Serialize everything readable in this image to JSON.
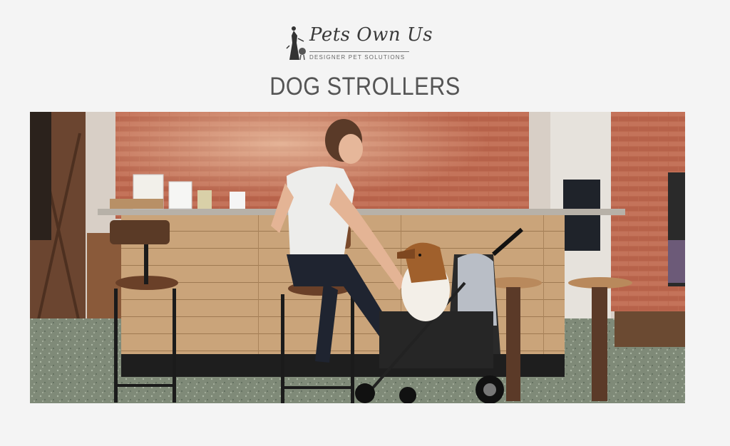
{
  "brand": {
    "name": "Pets Own Us",
    "tagline": "DESIGNER PET SOLUTIONS",
    "logo_icon": "pet-figure-logo-icon"
  },
  "page": {
    "title": "DOG STROLLERS"
  },
  "hero": {
    "alt": "Woman seated at a wooden bar counter petting a dog in a black pet stroller"
  },
  "colors": {
    "background": "#f4f4f4",
    "title_text": "#555555",
    "brick": "#b9604a",
    "wood": "#c49a6c"
  }
}
